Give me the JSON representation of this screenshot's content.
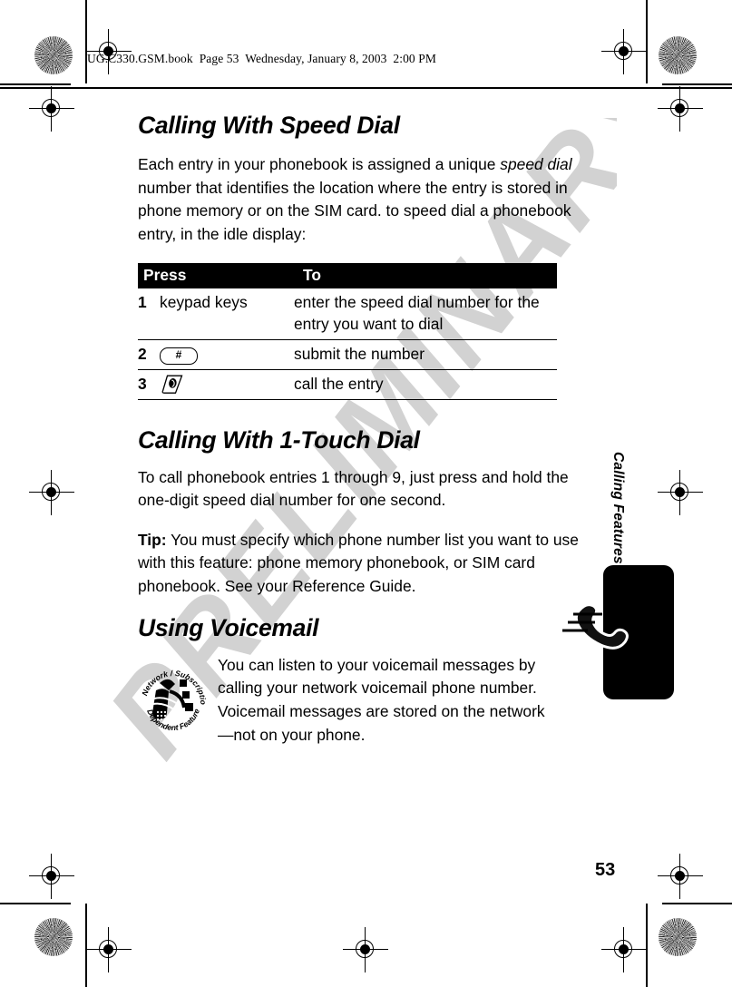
{
  "header": {
    "file_line": "UG.C330.GSM.book  Page 53  Wednesday, January 8, 2003  2:00 PM"
  },
  "watermark": {
    "text": "PRELIMINARY"
  },
  "sections": {
    "speed_dial": {
      "heading": "Calling With Speed Dial",
      "intro_part1": "Each entry in your phonebook is assigned a unique ",
      "intro_italic1": "speed dial",
      "intro_part2": " number that identifies the location where the entry is stored in phone memory or on the SIM card. to speed dial a phonebook entry, in the idle display:"
    },
    "one_touch": {
      "heading": "Calling With 1-Touch Dial",
      "body": "To call phonebook entries 1 through 9, just press and hold the one-digit speed dial number for one second.",
      "tip_label": "Tip:",
      "tip_body": " You must specify which phone number list you want to use with this feature: phone memory phonebook, or SIM card phonebook. See your Reference Guide."
    },
    "voicemail": {
      "heading": "Using Voicemail",
      "body": "You can listen to your voicemail messages by calling your network voicemail phone number. Voicemail messages are stored on the network—not on your phone.",
      "badge_text_top": "Network / Subscription",
      "badge_text_bottom": "Dependent Feature"
    }
  },
  "table": {
    "columns": [
      "Press",
      "To"
    ],
    "rows": [
      {
        "num": "1",
        "press_text": "keypad keys",
        "press_icon": "",
        "to": "enter the speed dial number for the entry you want to dial"
      },
      {
        "num": "2",
        "press_text": "",
        "press_icon": "hash-key-icon",
        "key_label": "#",
        "to": "submit the number"
      },
      {
        "num": "3",
        "press_text": "",
        "press_icon": "send-key-icon",
        "key_label": "",
        "to": "call the entry"
      }
    ]
  },
  "side": {
    "chapter_label": "Calling Features",
    "tab_icon": "ringing-handset-icon"
  },
  "footer": {
    "page_number": "53"
  },
  "colors": {
    "ink": "#000000",
    "watermark": "#d2d2d2",
    "paper": "#ffffff"
  }
}
